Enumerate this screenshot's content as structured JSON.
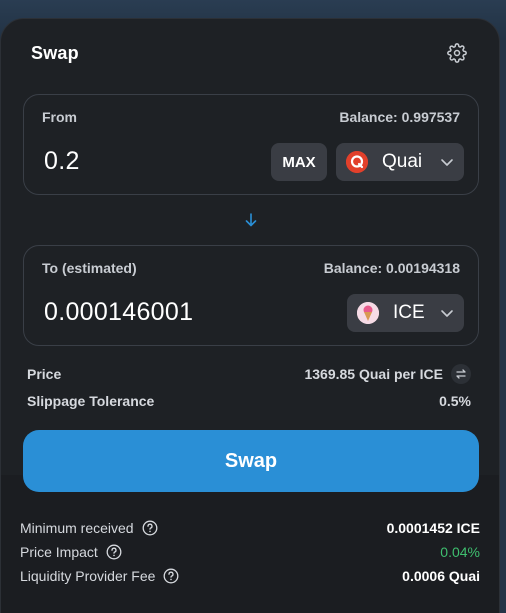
{
  "header": {
    "title": "Swap"
  },
  "from": {
    "label": "From",
    "balance": "Balance: 0.997537",
    "amount": "0.2",
    "max_label": "MAX",
    "token": "Quai"
  },
  "to": {
    "label": "To (estimated)",
    "balance": "Balance: 0.00194318",
    "amount": "0.000146001",
    "token": "ICE"
  },
  "info": {
    "price_label": "Price",
    "price_value": "1369.85 Quai per ICE",
    "slippage_label": "Slippage Tolerance",
    "slippage_value": "0.5%"
  },
  "swap_button": "Swap",
  "details": {
    "min_received_label": "Minimum received",
    "min_received_value": "0.0001452 ICE",
    "price_impact_label": "Price Impact",
    "price_impact_value": "0.04%",
    "lp_fee_label": "Liquidity Provider Fee",
    "lp_fee_value": "0.0006 Quai"
  },
  "colors": {
    "accent": "#2a8fd6",
    "price_impact": "#3fbf6f",
    "quai_brand": "#e2402b"
  }
}
